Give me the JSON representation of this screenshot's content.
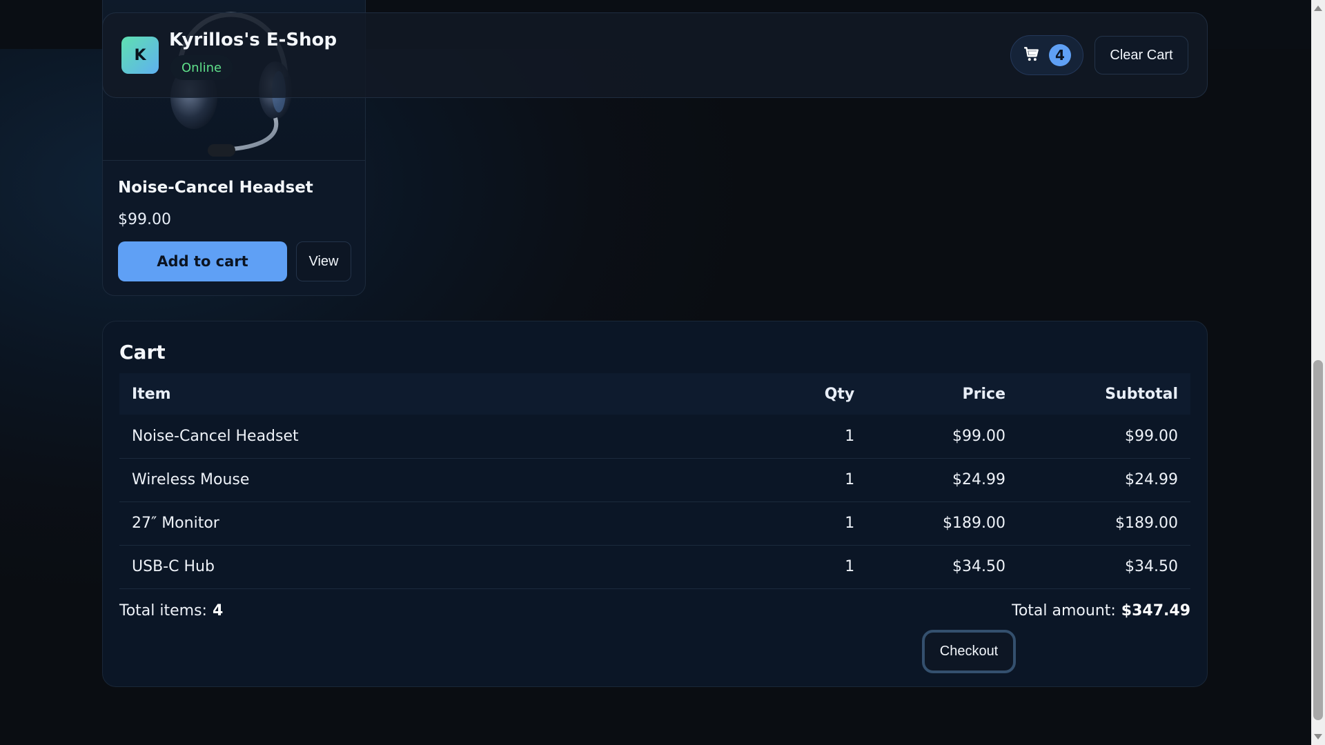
{
  "header": {
    "logo_letter": "K",
    "shop_name": "Kyrillos's E-Shop",
    "status": "Online",
    "cart_count": "4",
    "clear_cart_label": "Clear Cart",
    "cart_icon": "cart-icon"
  },
  "product": {
    "name": "Noise-Cancel Headset",
    "price": "$99.00",
    "add_label": "Add to cart",
    "view_label": "View",
    "image_icon": "headset-image"
  },
  "cart": {
    "title": "Cart",
    "columns": [
      "Item",
      "Qty",
      "Price",
      "Subtotal"
    ],
    "rows": [
      {
        "item": "Noise-Cancel Headset",
        "qty": "1",
        "price": "$99.00",
        "subtotal": "$99.00"
      },
      {
        "item": "Wireless Mouse",
        "qty": "1",
        "price": "$24.99",
        "subtotal": "$24.99"
      },
      {
        "item": "27″ Monitor",
        "qty": "1",
        "price": "$189.00",
        "subtotal": "$189.00"
      },
      {
        "item": "USB-C Hub",
        "qty": "1",
        "price": "$34.50",
        "subtotal": "$34.50"
      }
    ],
    "total_items_label": "Total items:",
    "total_items_value": "4",
    "total_amount_label": "Total amount:",
    "total_amount_value": "$347.49",
    "checkout_label": "Checkout"
  },
  "colors": {
    "accent": "#5fa0f5",
    "status_green": "#5fe08a",
    "background": "#0b1522"
  }
}
